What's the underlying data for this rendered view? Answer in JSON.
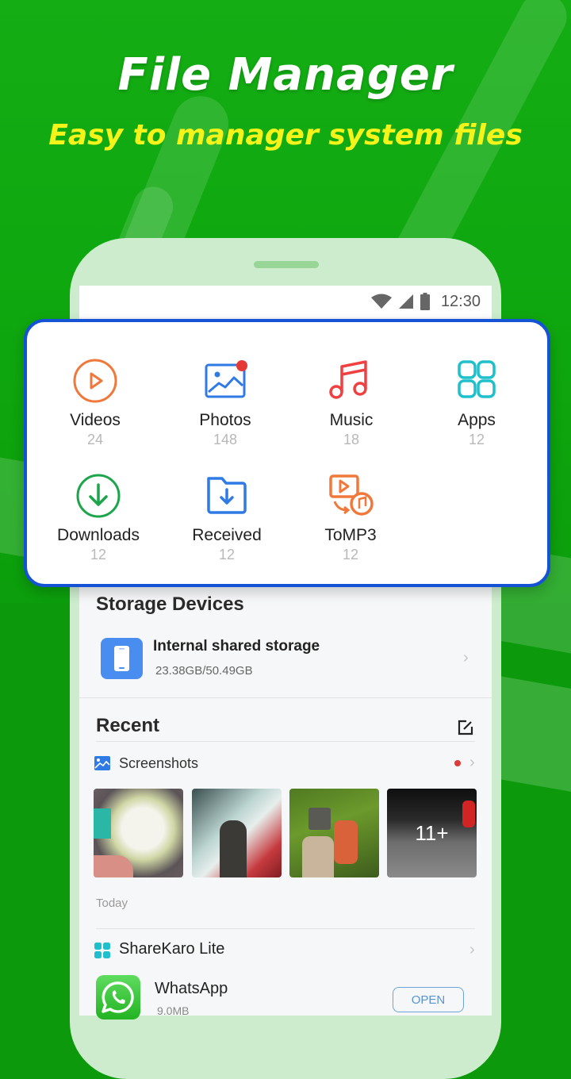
{
  "promo": {
    "title": "File Manager",
    "subtitle": "Easy to manager system files"
  },
  "status_bar": {
    "time": "12:30",
    "icons": [
      "wifi-icon",
      "signal-icon",
      "battery-icon"
    ]
  },
  "categories": [
    {
      "label": "Videos",
      "count": "24",
      "icon": "play-circle-icon",
      "color": "#f0783a"
    },
    {
      "label": "Photos",
      "count": "148",
      "icon": "image-icon",
      "color": "#2f7ae5",
      "badge": true
    },
    {
      "label": "Music",
      "count": "18",
      "icon": "music-note-icon",
      "color": "#ef4141"
    },
    {
      "label": "Apps",
      "count": "12",
      "icon": "apps-grid-icon",
      "color": "#1fc0cc"
    },
    {
      "label": "Downloads",
      "count": "12",
      "icon": "download-circle-icon",
      "color": "#1ca54a"
    },
    {
      "label": "Received",
      "count": "12",
      "icon": "folder-download-icon",
      "color": "#2f7ae5"
    },
    {
      "label": "ToMP3",
      "count": "12",
      "icon": "video-to-mp3-icon",
      "color": "#f0783a"
    }
  ],
  "storage": {
    "section_title": "Storage Devices",
    "device_name": "Internal shared storage",
    "device_usage": "23.38GB/50.49GB"
  },
  "recent": {
    "section_title": "Recent",
    "screenshots_label": "Screenshots",
    "more_count": "11+",
    "thumbnails": [
      "flowers",
      "person-in-smoke",
      "workers-carrying-baskets",
      "skier"
    ],
    "date_label": "Today",
    "app_group_label": "ShareKaro Lite",
    "app_name": "WhatsApp",
    "app_size": "9.0MB",
    "open_label": "OPEN"
  },
  "colors": {
    "background_green": "#0ea60e",
    "subtitle_yellow": "#f4f41a",
    "card_border": "#1553d6",
    "accent_blue": "#4a8df0"
  }
}
